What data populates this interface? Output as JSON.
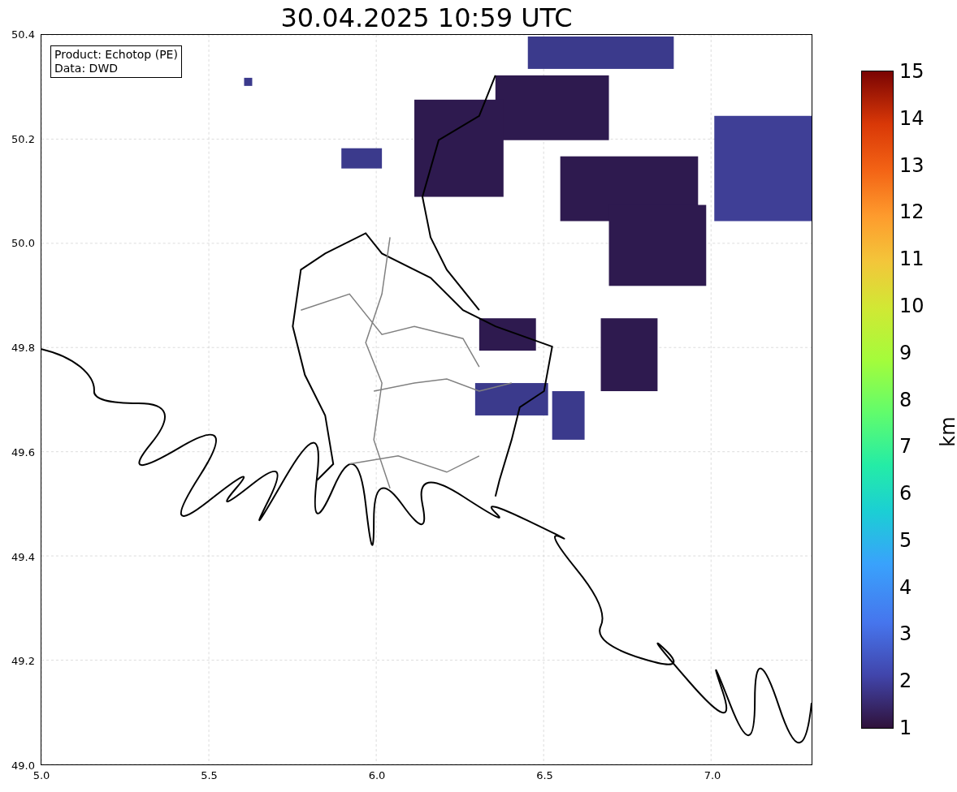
{
  "title": "30.04.2025 10:59 UTC",
  "legend": [
    "Product: Echotop (PE)",
    "Data: DWD"
  ],
  "x_ticks": [
    "5.0",
    "5.5",
    "6.0",
    "6.5",
    "7.0"
  ],
  "y_ticks": [
    "50.4",
    "50.2",
    "50.0",
    "49.8",
    "49.6",
    "49.4",
    "49.2",
    "49.0"
  ],
  "colorbar": {
    "label": "km",
    "ticks": [
      "15",
      "14",
      "13",
      "12",
      "11",
      "10",
      "9",
      "8",
      "7",
      "6",
      "5",
      "4",
      "3",
      "2",
      "1"
    ]
  }
}
